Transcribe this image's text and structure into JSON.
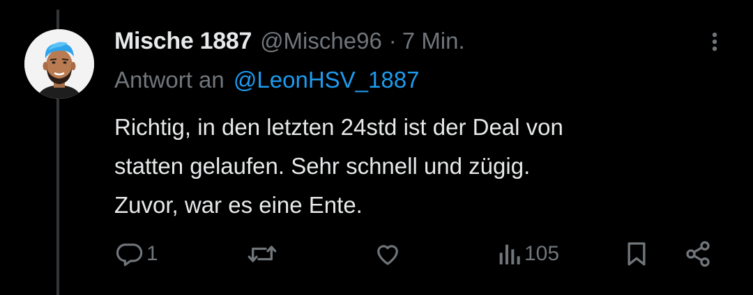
{
  "tweet": {
    "display_name": "Mische 1887",
    "handle": "@Mische96",
    "separator": "·",
    "time": "7 Min.",
    "reply_prefix": "Antwort an",
    "reply_mention": "@LeonHSV_1887",
    "text_lines": [
      "Richtig, in den letzten 24std ist der Deal von",
      "statten gelaufen. Sehr schnell und zügig.",
      "Zuvor, war es eine Ente."
    ]
  },
  "actions": {
    "reply_count": "1",
    "retweet_count": "",
    "like_count": "",
    "views_count": "105"
  },
  "icons": {
    "more": "more-dots-icon",
    "reply": "reply-bubble-icon",
    "retweet": "retweet-icon",
    "like": "heart-icon",
    "views": "views-bars-icon",
    "bookmark": "bookmark-icon",
    "share": "share-icon"
  },
  "colors": {
    "background": "#000000",
    "primary_text": "#e7e9ea",
    "secondary_text": "#71767b",
    "link": "#1d9bf0",
    "thread_line": "#333639"
  }
}
